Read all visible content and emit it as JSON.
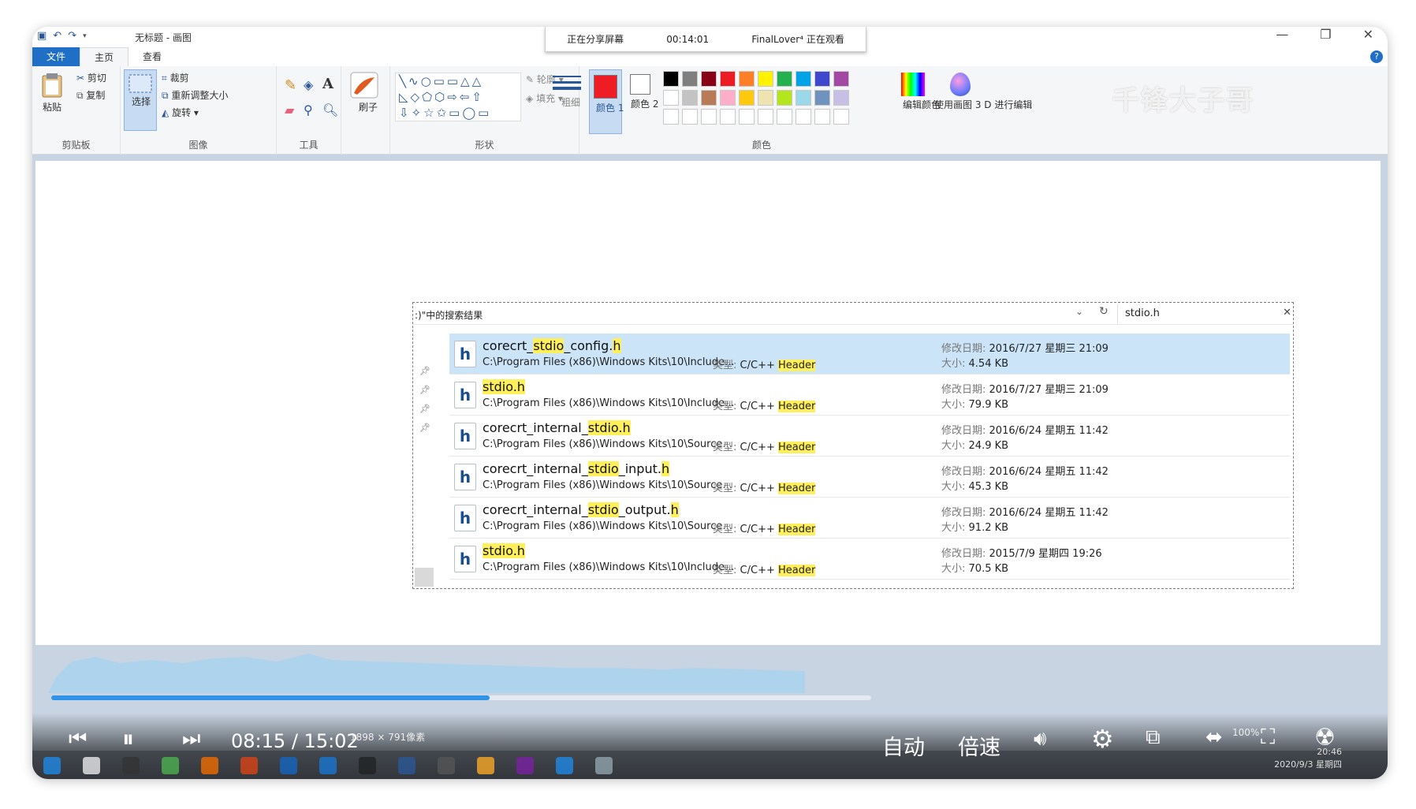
{
  "window": {
    "title": "无标题 - 画图",
    "controls": [
      "—",
      "❐",
      "✕"
    ]
  },
  "share_bar": {
    "status": "正在分享屏幕",
    "elapsed": "00:14:01",
    "viewer": "FinalLover⁴ 正在观看"
  },
  "ribbon_tabs": {
    "file": "文件",
    "home": "主页",
    "view": "查看"
  },
  "ribbon": {
    "clipboard": {
      "paste": "粘贴",
      "cut": "剪切",
      "copy": "复制",
      "group": "剪贴板"
    },
    "image": {
      "select": "选择",
      "crop": "裁剪",
      "resize": "重新调整大小",
      "rotate": "旋转",
      "group": "图像"
    },
    "tools": {
      "group": "工具"
    },
    "brush": {
      "label": "刷子"
    },
    "shapes": {
      "outline": "轮廓",
      "fill": "填充",
      "group": "形状"
    },
    "size": {
      "label": "粗细"
    },
    "colors": {
      "color1": "颜色 1",
      "color2": "颜色 2",
      "edit": "编辑颜色",
      "paint3d": "使用画图 3 D 进行编辑",
      "group": "颜色",
      "color1_value": "#ee1c24",
      "palette_row1": [
        "#000000",
        "#7f7f7f",
        "#880015",
        "#ed1c24",
        "#ff7f27",
        "#fff200",
        "#22b14c",
        "#00a2e8",
        "#3f48cc",
        "#a349a4"
      ],
      "palette_row2": [
        "#ffffff",
        "#c3c3c3",
        "#b97a57",
        "#ffaec9",
        "#ffc90e",
        "#efe4b0",
        "#b5e61d",
        "#99d9ea",
        "#7092be",
        "#c8bfe7"
      ]
    }
  },
  "search_results": {
    "location": ":)\"中的搜索结果",
    "query": "stdio.h",
    "items": [
      {
        "pre": "corecrt_",
        "hl": "stdio",
        "mid": "_config.",
        "hl2": "h",
        "path": "C:\\Program Files (x86)\\Windows Kits\\10\\Include...",
        "type_label": "类型:",
        "type_pre": "C/C++ ",
        "type_hl": "Header",
        "date_label": "修改日期:",
        "date": "2016/7/27 星期三 21:09",
        "size_label": "大小:",
        "size": "4.54 KB"
      },
      {
        "pre": "",
        "hl": "stdio.h",
        "mid": "",
        "hl2": "",
        "path": "C:\\Program Files (x86)\\Windows Kits\\10\\Include...",
        "type_label": "类型:",
        "type_pre": "C/C++ ",
        "type_hl": "Header",
        "date_label": "修改日期:",
        "date": "2016/7/27 星期三 21:09",
        "size_label": "大小:",
        "size": "79.9 KB"
      },
      {
        "pre": "corecrt_internal_",
        "hl": "stdio.h",
        "mid": "",
        "hl2": "",
        "path": "C:\\Program Files (x86)\\Windows Kits\\10\\Source...",
        "type_label": "类型:",
        "type_pre": "C/C++ ",
        "type_hl": "Header",
        "date_label": "修改日期:",
        "date": "2016/6/24 星期五 11:42",
        "size_label": "大小:",
        "size": "24.9 KB"
      },
      {
        "pre": "corecrt_internal_",
        "hl": "stdio",
        "mid": "_input.",
        "hl2": "h",
        "path": "C:\\Program Files (x86)\\Windows Kits\\10\\Source...",
        "type_label": "类型:",
        "type_pre": "C/C++ ",
        "type_hl": "Header",
        "date_label": "修改日期:",
        "date": "2016/6/24 星期五 11:42",
        "size_label": "大小:",
        "size": "45.3 KB"
      },
      {
        "pre": "corecrt_internal_",
        "hl": "stdio",
        "mid": "_output.",
        "hl2": "h",
        "path": "C:\\Program Files (x86)\\Windows Kits\\10\\Source...",
        "type_label": "类型:",
        "type_pre": "C/C++ ",
        "type_hl": "Header",
        "date_label": "修改日期:",
        "date": "2016/6/24 星期五 11:42",
        "size_label": "大小:",
        "size": "91.2 KB"
      },
      {
        "pre": "",
        "hl": "stdio.h",
        "mid": "",
        "hl2": "",
        "path": "C:\\Program Files (x86)\\Windows Kits\\10\\Include...",
        "type_label": "类型:",
        "type_pre": "C/C++ ",
        "type_hl": "Header",
        "date_label": "修改日期:",
        "date": "2015/7/9 星期四 19:26",
        "size_label": "大小:",
        "size": "70.5 KB"
      }
    ]
  },
  "status": {
    "dimensions": "1898 × 791像素",
    "zoom": "100%"
  },
  "player": {
    "current_time": "08:15",
    "separator": "/",
    "duration": "15:02",
    "progress": 0.5346,
    "auto_label": "自动",
    "speed_label": "倍速"
  },
  "tray": {
    "time": "20:46",
    "date": "2020/9/3 星期四"
  },
  "watermark": "千锋大子哥"
}
